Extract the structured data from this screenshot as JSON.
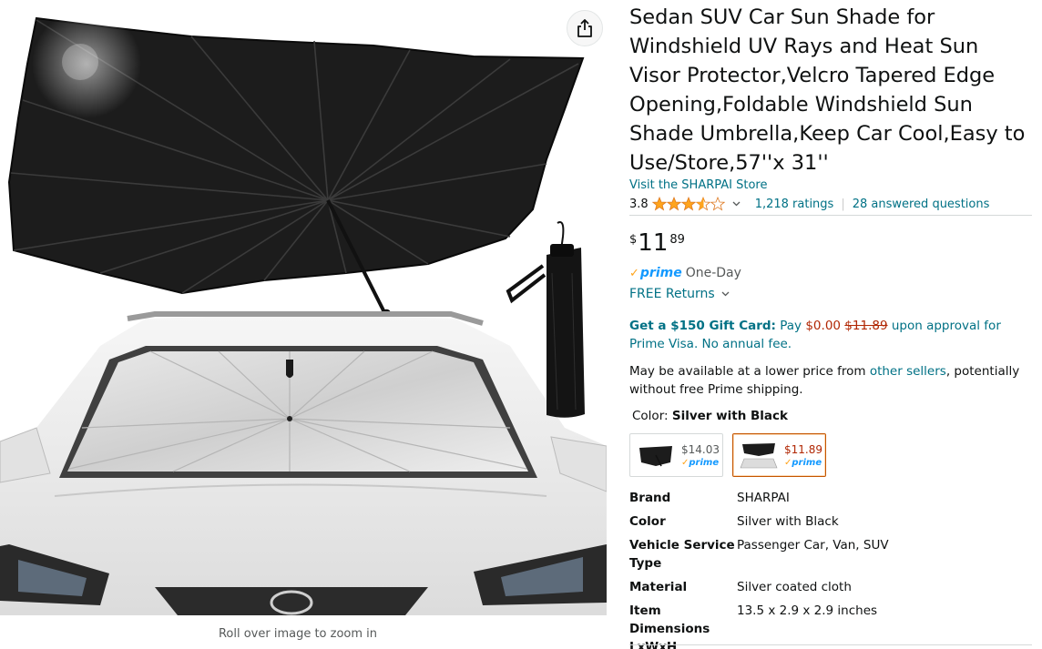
{
  "product": {
    "title": "Sedan SUV Car Sun Shade for Windshield UV Rays and Heat Sun Visor Protector,Velcro Tapered Edge Opening,Foldable Windshield Sun Shade Umbrella,Keep Car Cool,Easy to Use/Store,57''x 31''",
    "store_link": "Visit the SHARPAI Store",
    "rating": {
      "value": "3.8",
      "stars": 3.8,
      "ratings_count": "1,218 ratings",
      "separator": "|",
      "answered_questions": "28 answered questions"
    },
    "price": {
      "symbol": "$",
      "whole": "11",
      "fraction": "89"
    },
    "prime": {
      "check": "✓",
      "logo": "prime",
      "delivery": "One-Day"
    },
    "returns": "FREE Returns",
    "gift_card": {
      "lead": "Get a $150 Gift Card:",
      "pay": "Pay",
      "price": "$0.00",
      "strike": "$11.89",
      "tail": "upon approval for Prime Visa. No annual fee."
    },
    "lower_price": {
      "lead": "May be available at a lower price from",
      "link": "other sellers",
      "tail": ", potentially without free Prime shipping."
    },
    "color": {
      "label": "Color:",
      "value": "Silver with Black"
    },
    "swatches": [
      {
        "price": "$14.03",
        "prime": "prime",
        "selected": false
      },
      {
        "price": "$11.89",
        "prime": "prime",
        "selected": true
      }
    ],
    "specs": [
      {
        "label": "Brand",
        "value": "SHARPAI"
      },
      {
        "label": "Color",
        "value": "Silver with Black"
      },
      {
        "label": "Vehicle Service Type",
        "value": "Passenger Car, Van, SUV"
      },
      {
        "label": "Material",
        "value": "Silver coated cloth"
      },
      {
        "label": "Item Dimensions LxWxH",
        "value": "13.5 x 2.9 x 2.9 inches"
      }
    ]
  },
  "gallery": {
    "zoom_hint": "Roll over image to zoom in"
  },
  "colors": {
    "link": "#007185",
    "price_red": "#b12704",
    "prime_blue": "#1399ff",
    "star_orange": "#ffa41c",
    "selected_border": "#c45500"
  }
}
